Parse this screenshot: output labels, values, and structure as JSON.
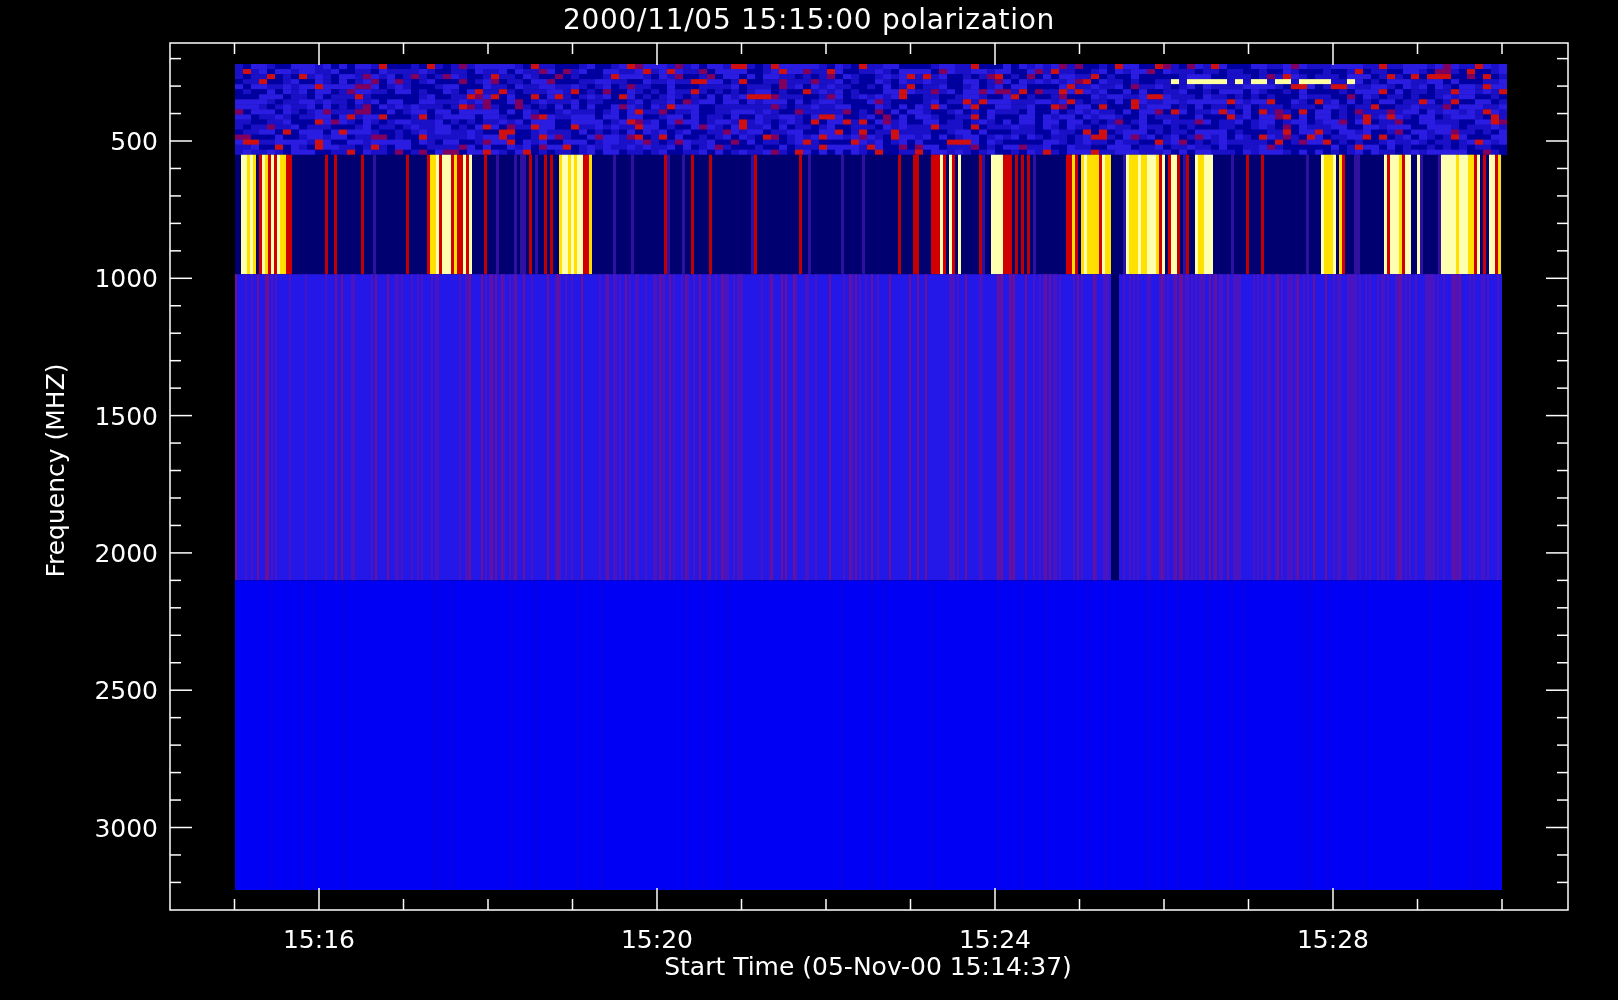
{
  "title": "2000/11/05 15:15:00 polarization",
  "plot": {
    "ylabel": "Frequency (MHZ)",
    "xlabel": "Start Time (05-Nov-00 15:14:37)",
    "yticks": [
      "500",
      "1000",
      "1500",
      "2000",
      "2500",
      "3000"
    ],
    "xticks": [
      "15:16",
      "15:20",
      "15:24",
      "15:28"
    ]
  }
}
